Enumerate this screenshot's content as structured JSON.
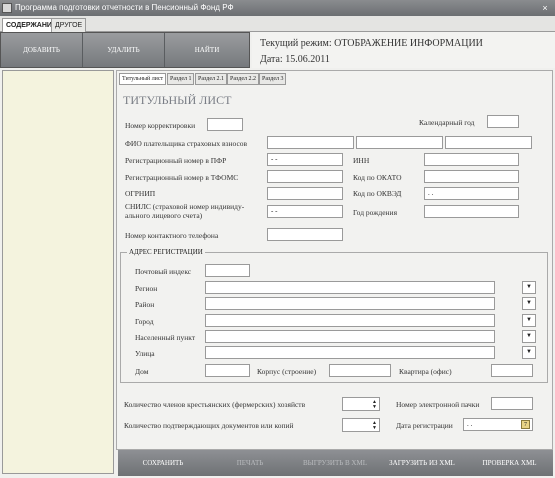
{
  "window": {
    "title": "Программа подготовки отчетности в Пенсионный Фонд РФ",
    "close": "×"
  },
  "tabs": [
    "СОДЕРЖАНИЕ",
    "ДРУГОЕ"
  ],
  "toolbar": {
    "add": "ДОБАВИТЬ",
    "delete": "УДАЛИТЬ",
    "find": "НАЙТИ"
  },
  "status": {
    "mode": "Текущий режим: ОТОБРАЖЕНИЕ ИНФОРМАЦИИ",
    "date": "Дата: 15.06.2011"
  },
  "subtabs": [
    "Титульный лист",
    "Раздел 1",
    "Раздел 2.1",
    "Раздел 2.2",
    "Раздел 3"
  ],
  "form": {
    "title": "ТИТУЛЬНЫЙ ЛИСТ",
    "correction_no": "Номер корректировки",
    "calendar_year": "Календарный год",
    "payer_name": "ФИО плательщика страховых взносов",
    "reg_pfr": "Регистрационный номер в ПФР",
    "reg_pfr_value": "- -",
    "inn": "ИНН",
    "reg_tfoms": "Регистрационный номер в ТФОМС",
    "okato": "Код по ОКАТО",
    "ogrnip": "ОГРНИП",
    "okved": "Код по ОКВЭД",
    "okved_value": ". .",
    "snils_1": "СНИЛС (страховой номер индивиду-",
    "snils_2": "ального лицевого счета)",
    "snils_value": "- -",
    "birth_year": "Год рождения",
    "phone": "Номер контактного телефона"
  },
  "address": {
    "title": "АДРЕС РЕГИСТРАЦИИ",
    "postal": "Почтовый индекс",
    "region": "Регион",
    "district": "Район",
    "city": "Город",
    "locality": "Населенный пункт",
    "street": "Улица",
    "house": "Дом",
    "building": "Корпус (строение)",
    "apartment": "Квартира (офис)",
    "dropdown_arrow": "▼"
  },
  "bottom_fields": {
    "farm_members": "Количество членов крестьянских (фермерских) хозяйств",
    "electronic_pack": "Номер электронной пачки",
    "docs_count": "Количество подтверждающих документов или копий",
    "reg_date": "Дата регистрации",
    "reg_date_value": ". .",
    "spin_up": "▲",
    "spin_down": "▼",
    "calendar_icon": "7"
  },
  "bottombar": {
    "save": "СОХРАНИТЬ",
    "print": "ПЕЧАТЬ",
    "export": "ВЫГРУЗИТЬ В XML",
    "import": "ЗАГРУЗИТЬ ИЗ XML",
    "check": "ПРОВЕРКА XML"
  }
}
